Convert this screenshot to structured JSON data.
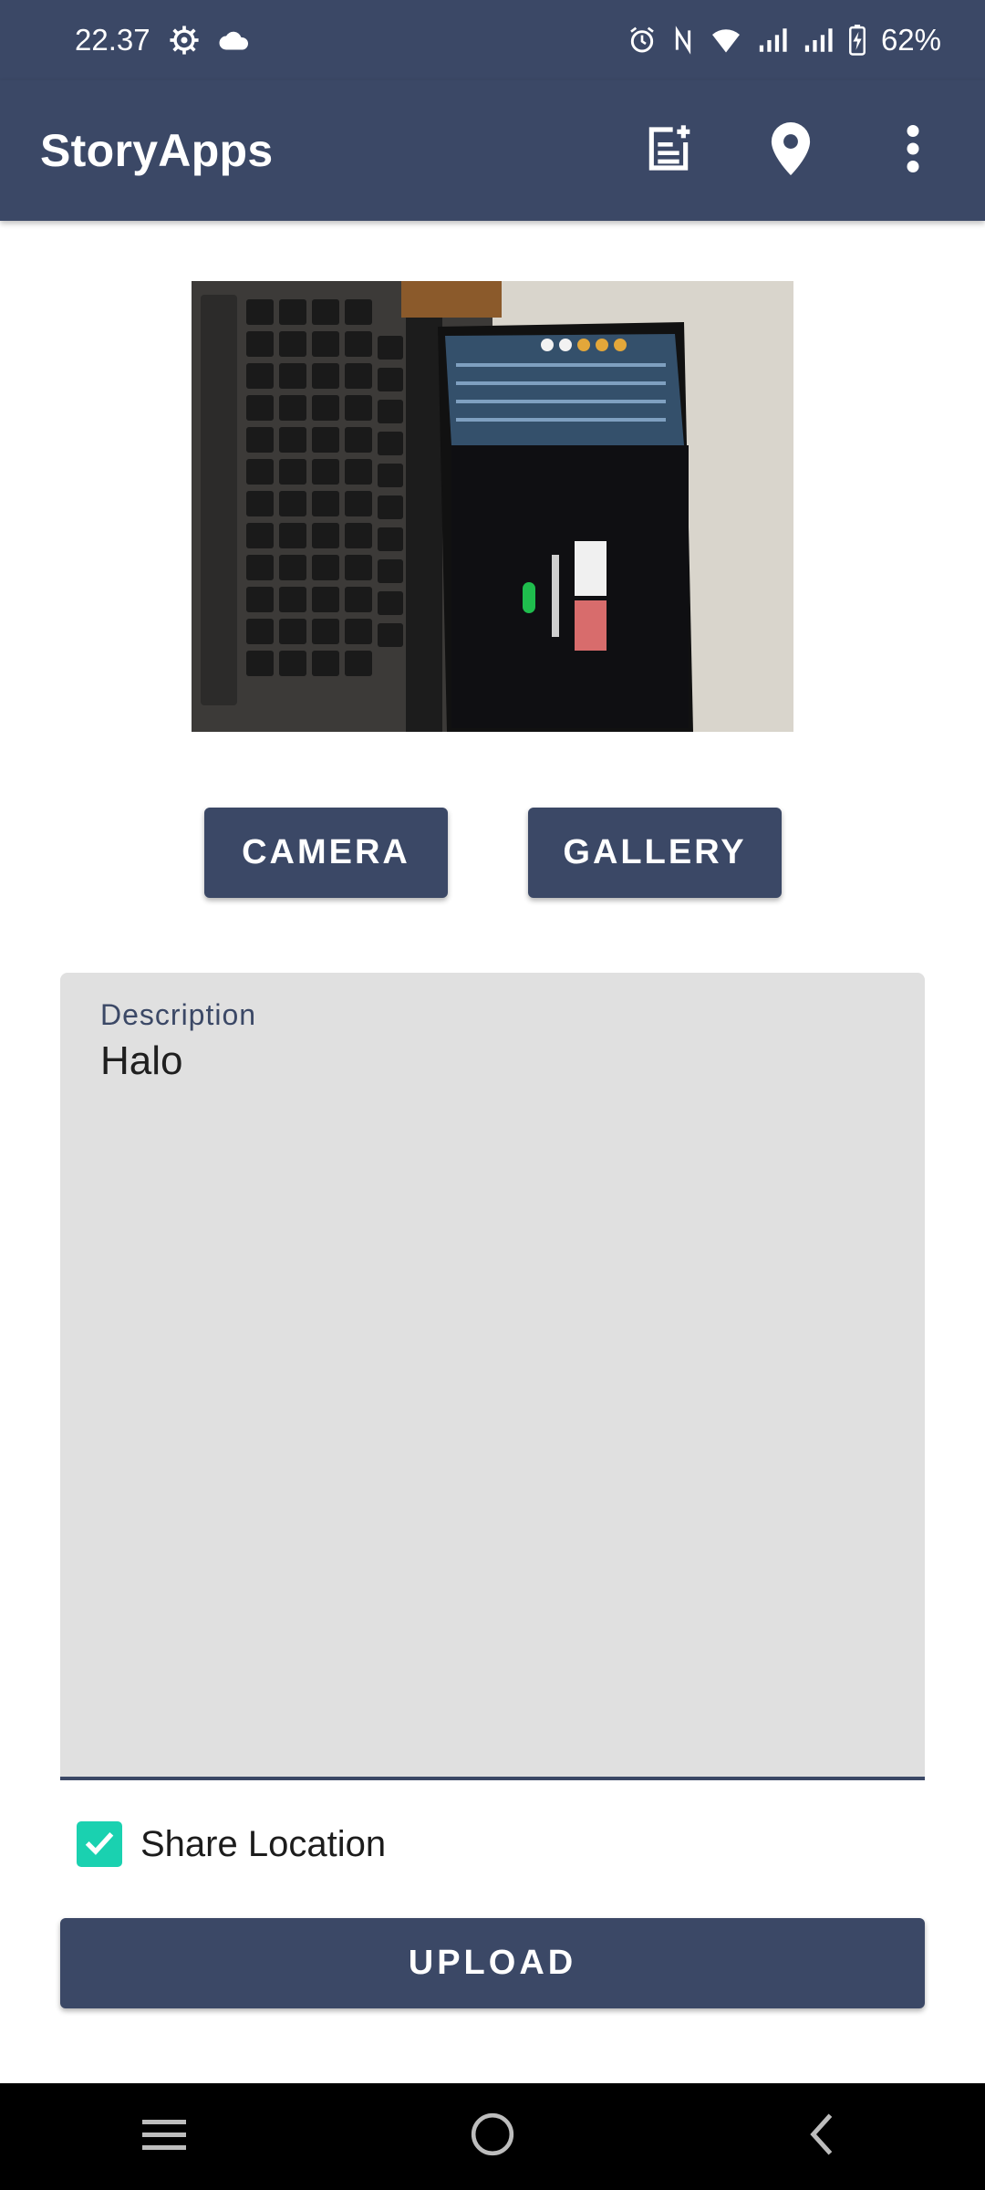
{
  "status_bar": {
    "time": "22.37",
    "battery": "62%"
  },
  "app_bar": {
    "title": "StoryApps"
  },
  "buttons": {
    "camera": "CAMERA",
    "gallery": "GALLERY",
    "upload": "UPLOAD"
  },
  "description": {
    "label": "Description",
    "value": "Halo"
  },
  "share_location": {
    "label": "Share Location",
    "checked": true
  },
  "colors": {
    "primary": "#3b4866",
    "checkbox": "#1ad1b0",
    "field_bg": "#e0e0e0"
  },
  "icons": {
    "status_left": [
      "gear-icon",
      "cloud-icon"
    ],
    "status_right": [
      "alarm-icon",
      "nfc-icon",
      "wifi-icon",
      "signal-icon",
      "signal-icon",
      "battery-charging-icon"
    ],
    "app_bar": [
      "add-story-icon",
      "location-pin-icon",
      "more-vert-icon"
    ],
    "nav": [
      "recent-apps-icon",
      "home-icon",
      "back-icon"
    ]
  }
}
